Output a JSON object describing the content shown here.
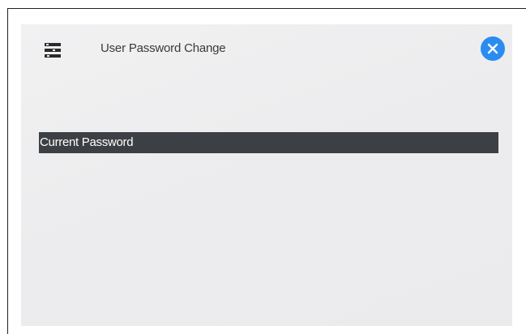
{
  "dialog": {
    "title": "User Password Change",
    "icon": "settings-sliders-icon",
    "close_icon": "close-icon",
    "accent_color": "#2a8cf0"
  },
  "form": {
    "current_password_label": "Current Password",
    "field_bar_color": "#3c3f44"
  }
}
